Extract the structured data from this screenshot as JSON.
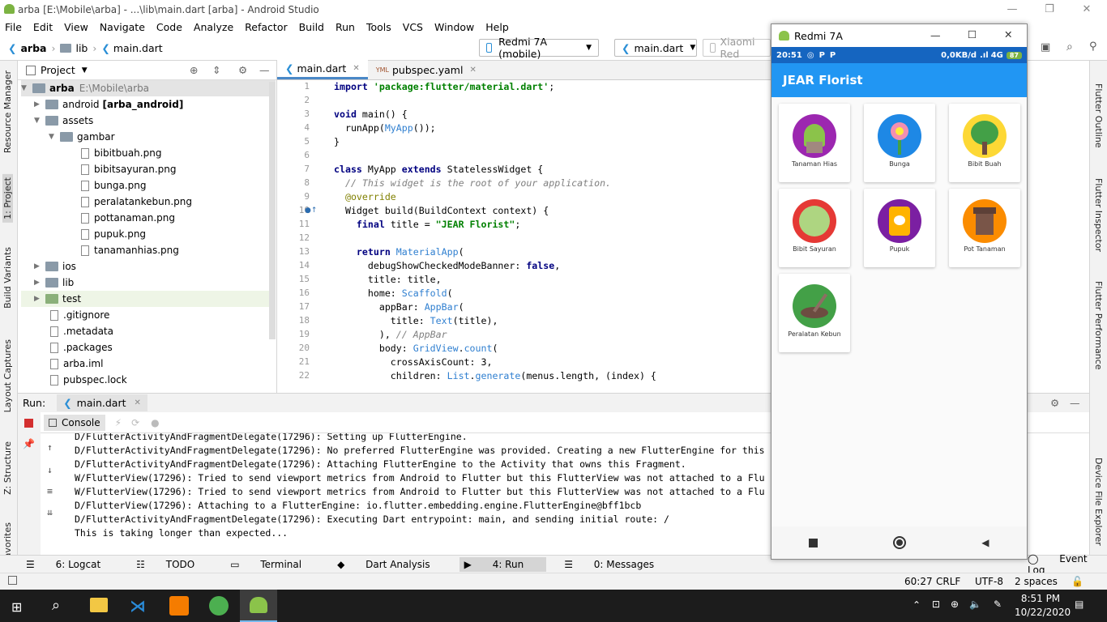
{
  "window": {
    "title": "arba [E:\\Mobile\\arba] - ...\\lib\\main.dart [arba] - Android Studio"
  },
  "menu": [
    "File",
    "Edit",
    "View",
    "Navigate",
    "Code",
    "Analyze",
    "Refactor",
    "Build",
    "Run",
    "Tools",
    "VCS",
    "Window",
    "Help"
  ],
  "breadcrumb": {
    "project": "arba",
    "folder": "lib",
    "file": "main.dart"
  },
  "toolbar": {
    "device": "Redmi 7A (mobile)",
    "config": "main.dart",
    "device2": "Xiaomi Red"
  },
  "project_panel": {
    "title": "Project",
    "root": "arba",
    "root_path": "E:\\Mobile\\arba",
    "items": [
      {
        "label": "android",
        "suffix": "[arba_android]"
      },
      {
        "label": "assets"
      },
      {
        "label": "gambar"
      },
      {
        "label": "bibitbuah.png"
      },
      {
        "label": "bibitsayuran.png"
      },
      {
        "label": "bunga.png"
      },
      {
        "label": "peralatankebun.png"
      },
      {
        "label": "pottanaman.png"
      },
      {
        "label": "pupuk.png"
      },
      {
        "label": "tanamanhias.png"
      },
      {
        "label": "ios"
      },
      {
        "label": "lib"
      },
      {
        "label": "test"
      },
      {
        "label": ".gitignore"
      },
      {
        "label": ".metadata"
      },
      {
        "label": ".packages"
      },
      {
        "label": "arba.iml"
      },
      {
        "label": "pubspec.lock"
      }
    ]
  },
  "editor": {
    "tabs": [
      "main.dart",
      "pubspec.yaml"
    ],
    "line_numbers": [
      "1",
      "2",
      "3",
      "4",
      "5",
      "6",
      "7",
      "8",
      "9",
      "10",
      "11",
      "12",
      "13",
      "14",
      "15",
      "16",
      "17",
      "18",
      "19",
      "20",
      "21",
      "22"
    ]
  },
  "run": {
    "label": "Run:",
    "config": "main.dart",
    "console_tab": "Console",
    "lines": [
      "D/FlutterActivityAndFragmentDelegate(17296): Setting up FlutterEngine.",
      "D/FlutterActivityAndFragmentDelegate(17296): No preferred FlutterEngine was provided. Creating a new FlutterEngine for this",
      "D/FlutterActivityAndFragmentDelegate(17296): Attaching FlutterEngine to the Activity that owns this Fragment.",
      "W/FlutterView(17296): Tried to send viewport metrics from Android to Flutter but this FlutterView was not attached to a Flu",
      "W/FlutterView(17296): Tried to send viewport metrics from Android to Flutter but this FlutterView was not attached to a Flu",
      "D/FlutterView(17296): Attaching to a FlutterEngine: io.flutter.embedding.engine.FlutterEngine@bff1bcb",
      "D/FlutterActivityAndFragmentDelegate(17296): Executing Dart entrypoint: main, and sending initial route: /",
      "This is taking longer than expected..."
    ]
  },
  "bottom_tabs": [
    "6: Logcat",
    "TODO",
    "Terminal",
    "Dart Analysis",
    "4: Run",
    "0: Messages"
  ],
  "event_log": "Event Log",
  "status": {
    "position": "60:27",
    "line_sep": "CRLF",
    "encoding": "UTF-8",
    "indent": "2 spaces"
  },
  "left_tabs": [
    "Resource Manager",
    "1: Project",
    "Build Variants",
    "Layout Captures",
    "Z: Structure",
    "Favorites"
  ],
  "right_tabs": [
    "Flutter Outline",
    "Flutter Inspector",
    "Flutter Performance",
    "Device File Explorer"
  ],
  "emulator": {
    "title": "Redmi 7A",
    "time": "20:51",
    "net": "0,0KB/d",
    "signal": "4G",
    "battery": "87",
    "app_title": "JEAR Florist",
    "menus": [
      {
        "label": "Tanaman Hias",
        "color": "#9c27b0"
      },
      {
        "label": "Bunga",
        "color": "#1e88e5"
      },
      {
        "label": "Bibit Buah",
        "color": "#fdd835"
      },
      {
        "label": "Bibit Sayuran",
        "color": "#e53935"
      },
      {
        "label": "Pupuk",
        "color": "#7b1fa2"
      },
      {
        "label": "Pot Tanaman",
        "color": "#fb8c00"
      },
      {
        "label": "Peralatan Kebun",
        "color": "#43a047"
      }
    ]
  },
  "clock": {
    "time": "8:51 PM",
    "date": "10/22/2020"
  }
}
